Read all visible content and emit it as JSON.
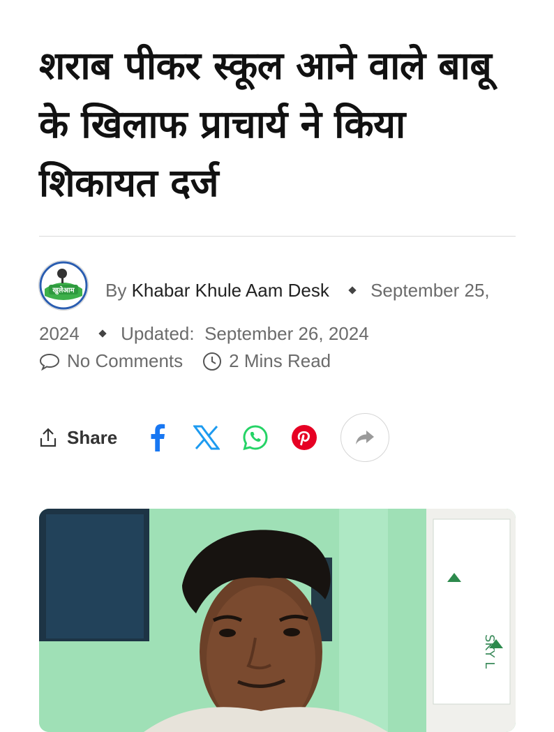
{
  "article": {
    "title": "शराब पीकर स्कूल आने वाले बाबू के खिलाफ प्राचार्य ने किया शिकायत दर्ज",
    "by_label": "By",
    "author": "Khabar Khule Aam Desk",
    "published": "September 25, 2024",
    "updated_label": "Updated:",
    "updated": "September 26, 2024",
    "comments": "No Comments",
    "read_time": "2 Mins Read"
  },
  "logo": {
    "text": "खुलेआम"
  },
  "share": {
    "label": "Share",
    "icons": [
      "facebook-icon",
      "x-icon",
      "whatsapp-icon",
      "pinterest-icon",
      "forward-icon"
    ]
  },
  "photo": {
    "board_text": "SKY L"
  },
  "colors": {
    "facebook": "#1877f2",
    "x": "#1d9bf0",
    "whatsapp": "#25d366",
    "pinterest": "#e60023",
    "wall": "#9fe0b6"
  }
}
